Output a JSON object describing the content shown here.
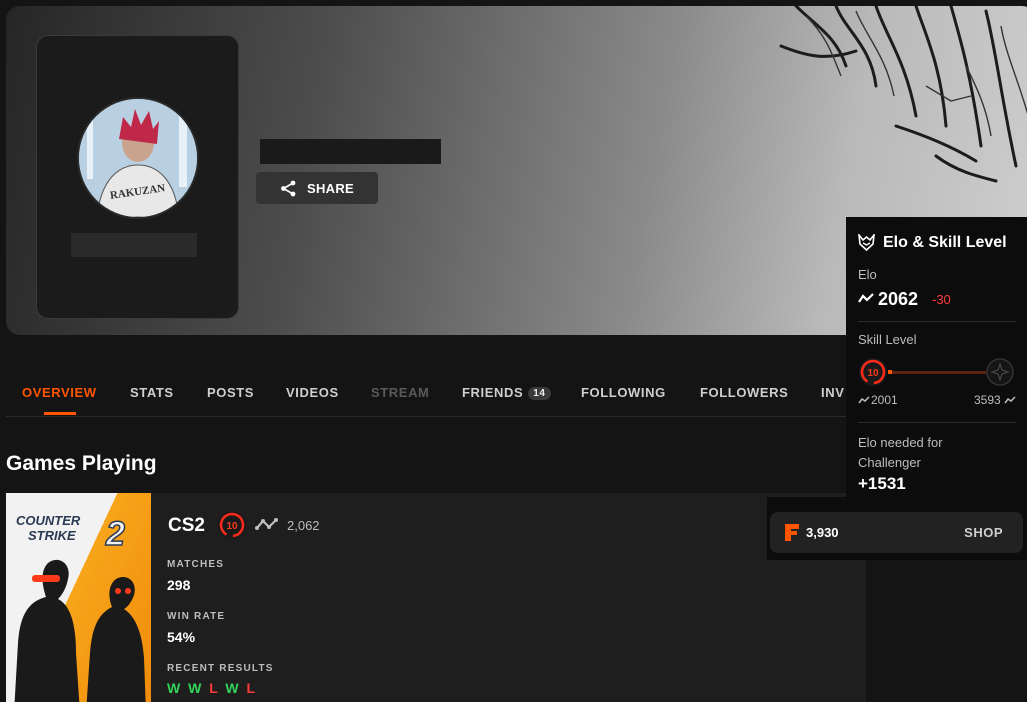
{
  "profile": {
    "share_label": "SHARE"
  },
  "nav": {
    "items": [
      {
        "label": "OVERVIEW",
        "state": "active"
      },
      {
        "label": "STATS",
        "state": "normal"
      },
      {
        "label": "POSTS",
        "state": "normal"
      },
      {
        "label": "VIDEOS",
        "state": "normal"
      },
      {
        "label": "STREAM",
        "state": "disabled"
      },
      {
        "label": "FRIENDS",
        "state": "normal",
        "badge": "14"
      },
      {
        "label": "FOLLOWING",
        "state": "normal"
      },
      {
        "label": "FOLLOWERS",
        "state": "normal"
      },
      {
        "label": "INV",
        "state": "normal"
      }
    ]
  },
  "games_section": {
    "title": "Games Playing"
  },
  "game": {
    "cover_line1": "COUNTER",
    "cover_line2": "STRIKE",
    "cover_number": "2",
    "name": "CS2",
    "level": "10",
    "elo": "2,062",
    "matches_label": "MATCHES",
    "matches_value": "298",
    "winrate_label": "WIN RATE",
    "winrate_value": "54%",
    "recent_label": "RECENT RESULTS",
    "recent_results": [
      "W",
      "W",
      "L",
      "W",
      "L"
    ]
  },
  "shop": {
    "points": "3,930",
    "button_label": "SHOP"
  },
  "elo_panel": {
    "title": "Elo & Skill Level",
    "elo_label": "Elo",
    "elo_value": "2062",
    "elo_delta": "-30",
    "skill_label": "Skill Level",
    "current_level": "10",
    "range_min": "2001",
    "range_max": "3593",
    "needed_label": "Elo needed for Challenger",
    "needed_value": "+1531"
  },
  "colors": {
    "accent": "#ff5500",
    "win": "#32d35a",
    "loss": "#ff3b3b"
  }
}
